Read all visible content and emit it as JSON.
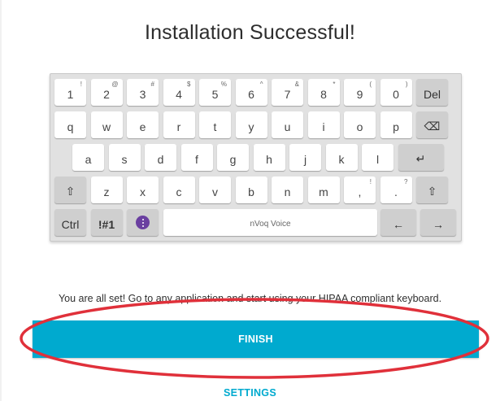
{
  "title": "Installation Successful!",
  "keyboard": {
    "row1": [
      {
        "main": "1",
        "sup": "!"
      },
      {
        "main": "2",
        "sup": "@"
      },
      {
        "main": "3",
        "sup": "#"
      },
      {
        "main": "4",
        "sup": "$"
      },
      {
        "main": "5",
        "sup": "%"
      },
      {
        "main": "6",
        "sup": "^"
      },
      {
        "main": "7",
        "sup": "&"
      },
      {
        "main": "8",
        "sup": "*"
      },
      {
        "main": "9",
        "sup": "("
      },
      {
        "main": "0",
        "sup": ")"
      },
      {
        "main": "Del",
        "sup": ""
      }
    ],
    "row2": [
      "q",
      "w",
      "e",
      "r",
      "t",
      "y",
      "u",
      "i",
      "o",
      "p",
      "⌫"
    ],
    "row3": [
      "a",
      "s",
      "d",
      "f",
      "g",
      "h",
      "j",
      "k",
      "l",
      "↵"
    ],
    "row4": [
      {
        "main": "⇧",
        "sup": ""
      },
      {
        "main": "z",
        "sup": ""
      },
      {
        "main": "x",
        "sup": ""
      },
      {
        "main": "c",
        "sup": ""
      },
      {
        "main": "v",
        "sup": ""
      },
      {
        "main": "b",
        "sup": ""
      },
      {
        "main": "n",
        "sup": ""
      },
      {
        "main": "m",
        "sup": ""
      },
      {
        "main": ",",
        "sup": "!"
      },
      {
        "main": ".",
        "sup": "?"
      },
      {
        "main": "⇧",
        "sup": ""
      }
    ],
    "row5": {
      "ctrl": "Ctrl",
      "symbols": "!#1",
      "space": "nVoq Voice",
      "left_arrow": "←",
      "right_arrow": "→"
    },
    "colors": {
      "background": "#e1e1e1",
      "key": "#ffffff",
      "modifier_key": "#cfcfcf",
      "voice_icon": "#6a3fa0"
    }
  },
  "message": "You are all set! Go to any application and start using your HIPAA compliant keyboard.",
  "finish_label": "FINISH",
  "settings_label": "SETTINGS",
  "accent_color": "#00aacf",
  "annotation_color": "#e0303a"
}
